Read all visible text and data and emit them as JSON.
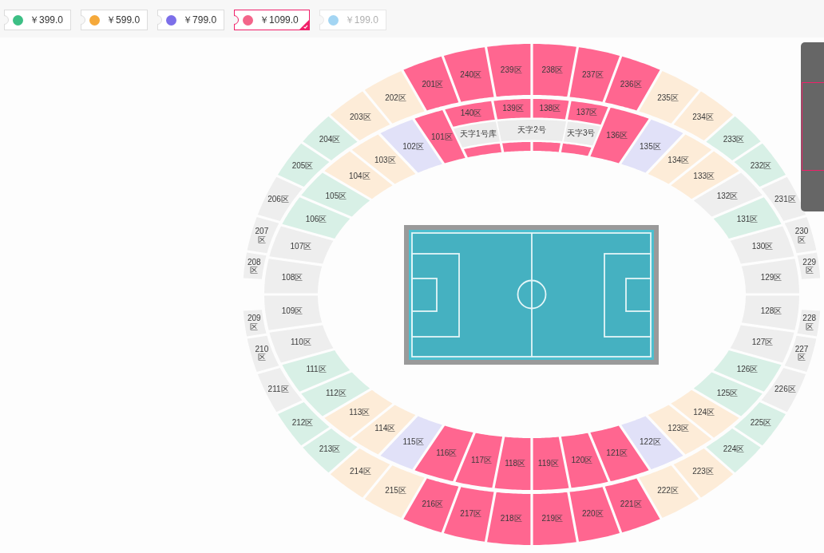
{
  "price_tabs": [
    {
      "price": "￥399.0",
      "color": "#3dbf85",
      "selected": false,
      "disabled": false
    },
    {
      "price": "￥599.0",
      "color": "#f5a93b",
      "selected": false,
      "disabled": false
    },
    {
      "price": "￥799.0",
      "color": "#7c6fe9",
      "selected": false,
      "disabled": false
    },
    {
      "price": "￥1099.0",
      "color": "#f3658a",
      "selected": true,
      "disabled": false
    },
    {
      "price": "￥199.0",
      "color": "#a3d5f3",
      "selected": false,
      "disabled": true
    }
  ],
  "stadium": {
    "inner_ring": [
      {
        "label": "101区",
        "color": "#ff6690"
      },
      {
        "label": "102区",
        "color": "#e1e1f8"
      },
      {
        "label": "103区",
        "color": "#fdecd8"
      },
      {
        "label": "104区",
        "color": "#fdecd8"
      },
      {
        "label": "105区",
        "color": "#d8f0e6"
      },
      {
        "label": "106区",
        "color": "#d8f0e6"
      },
      {
        "label": "107区",
        "color": "#eeeeee"
      },
      {
        "label": "108区",
        "color": "#eeeeee"
      },
      {
        "label": "109区",
        "color": "#eeeeee"
      },
      {
        "label": "110区",
        "color": "#eeeeee"
      },
      {
        "label": "111区",
        "color": "#d8f0e6"
      },
      {
        "label": "112区",
        "color": "#d8f0e6"
      },
      {
        "label": "113区",
        "color": "#fdecd8"
      },
      {
        "label": "114区",
        "color": "#fdecd8"
      },
      {
        "label": "115区",
        "color": "#e1e1f8"
      },
      {
        "label": "116区",
        "color": "#ff6690"
      },
      {
        "label": "117区",
        "color": "#ff6690"
      },
      {
        "label": "118区",
        "color": "#ff6690"
      },
      {
        "label": "119区",
        "color": "#ff6690"
      },
      {
        "label": "120区",
        "color": "#ff6690"
      },
      {
        "label": "121区",
        "color": "#ff6690"
      },
      {
        "label": "122区",
        "color": "#e1e1f8"
      },
      {
        "label": "123区",
        "color": "#fdecd8"
      },
      {
        "label": "124区",
        "color": "#fdecd8"
      },
      {
        "label": "125区",
        "color": "#d8f0e6"
      },
      {
        "label": "126区",
        "color": "#d8f0e6"
      },
      {
        "label": "127区",
        "color": "#eeeeee"
      },
      {
        "label": "128区",
        "color": "#eeeeee"
      },
      {
        "label": "129区",
        "color": "#eeeeee"
      },
      {
        "label": "130区",
        "color": "#eeeeee"
      },
      {
        "label": "131区",
        "color": "#d8f0e6"
      },
      {
        "label": "132区",
        "color": "#eeeeee"
      },
      {
        "label": "133区",
        "color": "#fdecd8"
      },
      {
        "label": "134区",
        "color": "#fdecd8"
      },
      {
        "label": "135区",
        "color": "#e1e1f8"
      },
      {
        "label": "136区",
        "color": "#ff6690"
      },
      {
        "label": "137区",
        "color": "#ff6690"
      },
      {
        "label": "138区",
        "color": "#ff6690"
      },
      {
        "label": "139区",
        "color": "#ff6690"
      },
      {
        "label": "140区",
        "color": "#ff6690"
      }
    ],
    "outer_ring": [
      {
        "label": "201区",
        "color": "#ff6690"
      },
      {
        "label": "202区",
        "color": "#fdecd8"
      },
      {
        "label": "203区",
        "color": "#fdecd8"
      },
      {
        "label": "204区",
        "color": "#d8f0e6"
      },
      {
        "label": "205区",
        "color": "#d8f0e6"
      },
      {
        "label": "206区",
        "color": "#eeeeee"
      },
      {
        "label": "207区",
        "color": "#eeeeee"
      },
      {
        "label": "208区",
        "color": "#eeeeee"
      },
      {
        "label": "209区",
        "color": "#eeeeee"
      },
      {
        "label": "210区",
        "color": "#eeeeee"
      },
      {
        "label": "211区",
        "color": "#eeeeee"
      },
      {
        "label": "212区",
        "color": "#d8f0e6"
      },
      {
        "label": "213区",
        "color": "#d8f0e6"
      },
      {
        "label": "214区",
        "color": "#fdecd8"
      },
      {
        "label": "215区",
        "color": "#fdecd8"
      },
      {
        "label": "216区",
        "color": "#ff6690"
      },
      {
        "label": "217区",
        "color": "#ff6690"
      },
      {
        "label": "218区",
        "color": "#ff6690"
      },
      {
        "label": "219区",
        "color": "#ff6690"
      },
      {
        "label": "220区",
        "color": "#ff6690"
      },
      {
        "label": "221区",
        "color": "#ff6690"
      },
      {
        "label": "222区",
        "color": "#fdecd8"
      },
      {
        "label": "223区",
        "color": "#fdecd8"
      },
      {
        "label": "224区",
        "color": "#d8f0e6"
      },
      {
        "label": "225区",
        "color": "#d8f0e6"
      },
      {
        "label": "226区",
        "color": "#eeeeee"
      },
      {
        "label": "227区",
        "color": "#eeeeee"
      },
      {
        "label": "228区",
        "color": "#eeeeee"
      },
      {
        "label": "229区",
        "color": "#eeeeee"
      },
      {
        "label": "230区",
        "color": "#eeeeee"
      },
      {
        "label": "231区",
        "color": "#eeeeee"
      },
      {
        "label": "232区",
        "color": "#d8f0e6"
      },
      {
        "label": "233区",
        "color": "#d8f0e6"
      },
      {
        "label": "234区",
        "color": "#fdecd8"
      },
      {
        "label": "235区",
        "color": "#fdecd8"
      },
      {
        "label": "236区",
        "color": "#ff6690"
      },
      {
        "label": "237区",
        "color": "#ff6690"
      },
      {
        "label": "238区",
        "color": "#ff6690"
      },
      {
        "label": "239区",
        "color": "#ff6690"
      },
      {
        "label": "240区",
        "color": "#ff6690"
      }
    ],
    "boxes": [
      {
        "label": "天字1号库"
      },
      {
        "label": "天字2号"
      },
      {
        "label": "天字3号"
      }
    ]
  }
}
